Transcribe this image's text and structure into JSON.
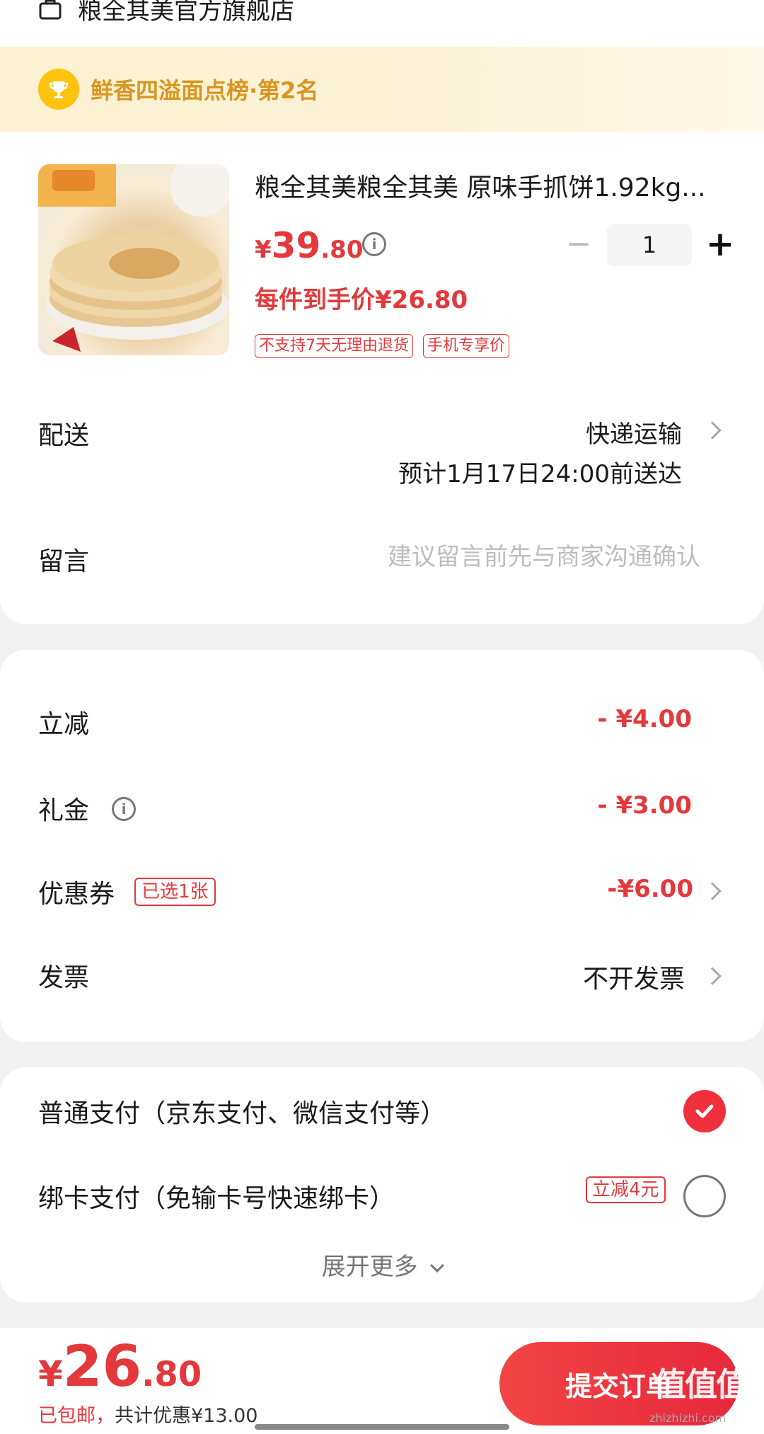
{
  "store": {
    "name": "粮全其美官方旗舰店",
    "icon": "store-icon"
  },
  "rank_banner": {
    "text": "鲜香四溢面点榜·第2名",
    "icon": "trophy-icon"
  },
  "product": {
    "title": "粮全其美粮全其美 原味手抓饼1.92kg...",
    "price_currency": "¥",
    "price_int": "39",
    "price_dec": ".80",
    "quantity": "1",
    "minus_label": "−",
    "plus_label": "+",
    "unit_price": "每件到手价¥26.80",
    "tags": [
      "不支持7天无理由退货",
      "手机专享价"
    ]
  },
  "delivery": {
    "label": "配送",
    "method": "快递运输",
    "eta": "预计1月17日24:00前送达"
  },
  "note": {
    "label": "留言",
    "placeholder": "建议留言前先与商家沟通确认"
  },
  "discounts": {
    "instant": {
      "label": "立减",
      "amount": "- ¥4.00"
    },
    "gift": {
      "label": "礼金",
      "amount": "- ¥3.00"
    },
    "coupon": {
      "label": "优惠券",
      "badge": "已选1张",
      "amount": "-¥6.00"
    },
    "invoice": {
      "label": "发票",
      "value": "不开发票"
    }
  },
  "payment": {
    "normal": {
      "label": "普通支付（京东支付、微信支付等）",
      "selected": true
    },
    "card": {
      "label": "绑卡支付（免输卡号快速绑卡）",
      "promo": "立减4元",
      "selected": false
    },
    "expand": "展开更多"
  },
  "footer": {
    "total_currency": "¥",
    "total_int": "26",
    "total_dec": ".80",
    "shipping": "已包邮，",
    "savings": "共计优惠¥13.00",
    "submit": "提交订单"
  },
  "watermark": {
    "text": "值值值",
    "sub": "zhizhizhi.com"
  },
  "colors": {
    "accent": "#e4393c",
    "banner_text": "#d99520",
    "trophy": "#ffc20e"
  }
}
